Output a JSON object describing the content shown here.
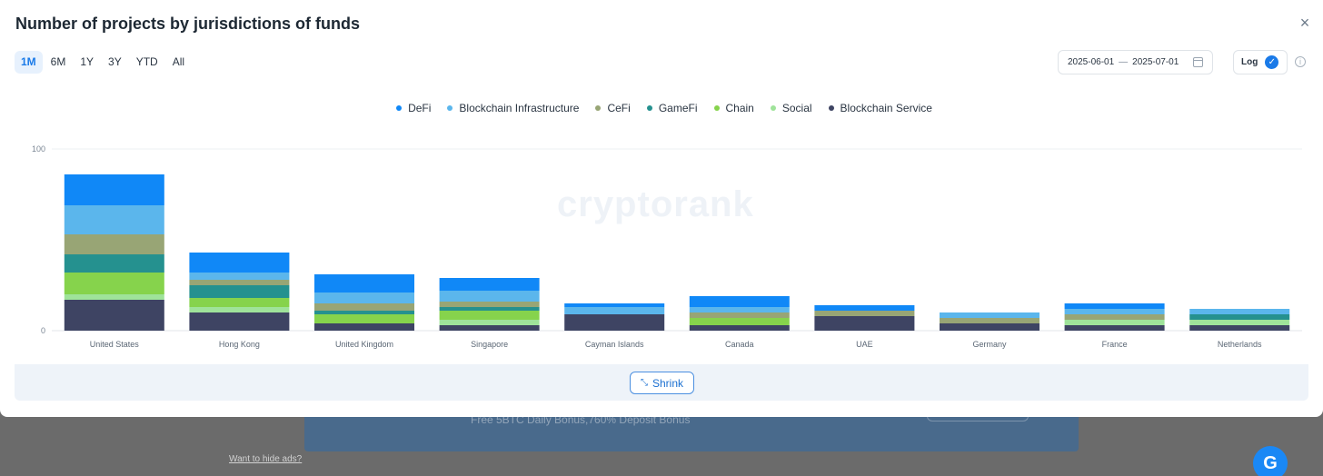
{
  "background": {
    "ad_text": "Free 5BTC Daily Bonus,760% Deposit Bonus",
    "hide_ads_link": "Want to hide ads?",
    "fab_icon": "cryptorank-logo-icon",
    "fab_glyph": "G"
  },
  "modal": {
    "title": "Number of projects by jurisdictions of funds",
    "close_glyph": "×",
    "ranges": [
      "1M",
      "6M",
      "1Y",
      "3Y",
      "YTD",
      "All"
    ],
    "active_range": "1M",
    "date_from": "2025-06-01",
    "date_sep": "—",
    "date_to": "2025-07-01",
    "log_label": "Log",
    "log_checked": true,
    "check_glyph": "✓",
    "info_glyph": "i",
    "watermark": "cryptorank",
    "shrink_label": "Shrink",
    "shrink_glyph": "⤡"
  },
  "chart_data": {
    "type": "bar",
    "stacked": true,
    "log_scale": true,
    "ylim": [
      0,
      100
    ],
    "y_ticks": [
      "100",
      "0"
    ],
    "legend_position": "top-center",
    "categories": [
      "United States",
      "Hong Kong",
      "United Kingdom",
      "Singapore",
      "Cayman Islands",
      "Canada",
      "UAE",
      "Germany",
      "France",
      "Netherlands"
    ],
    "series": [
      {
        "name": "Blockchain Service",
        "color": "#3e4463",
        "values": [
          17,
          10,
          4,
          3,
          9,
          3,
          8,
          4,
          3,
          3
        ]
      },
      {
        "name": "Social",
        "color": "#9fe39a",
        "values": [
          3,
          3,
          0,
          3,
          0,
          0,
          0,
          0,
          3,
          3
        ]
      },
      {
        "name": "Chain",
        "color": "#86d34c",
        "values": [
          12,
          5,
          5,
          5,
          0,
          4,
          0,
          0,
          0,
          0
        ]
      },
      {
        "name": "GameFi",
        "color": "#25918f",
        "values": [
          10,
          7,
          2,
          2,
          0,
          0,
          0,
          0,
          0,
          3
        ]
      },
      {
        "name": "CeFi",
        "color": "#98a575",
        "values": [
          11,
          3,
          4,
          3,
          0,
          3,
          3,
          3,
          3,
          0
        ]
      },
      {
        "name": "Blockchain Infrastructure",
        "color": "#5bb6ec",
        "values": [
          16,
          4,
          6,
          6,
          4,
          3,
          0,
          3,
          3,
          3
        ]
      },
      {
        "name": "DeFi",
        "color": "#1088f7",
        "values": [
          17,
          11,
          10,
          7,
          2,
          6,
          3,
          0,
          3,
          0
        ]
      }
    ],
    "legend_order": [
      "DeFi",
      "Blockchain Infrastructure",
      "CeFi",
      "GameFi",
      "Chain",
      "Social",
      "Blockchain Service"
    ]
  }
}
